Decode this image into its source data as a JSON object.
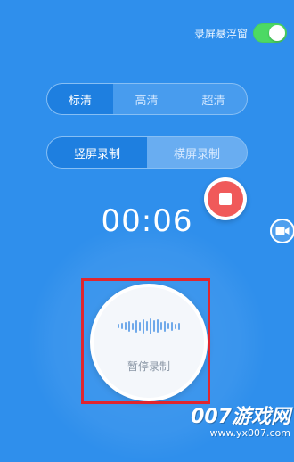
{
  "floating_window": {
    "label": "录屏悬浮窗",
    "enabled": true
  },
  "quality": {
    "options": [
      "标清",
      "高清",
      "超清"
    ],
    "selected": "标清"
  },
  "orientation": {
    "options": [
      "竖屏录制",
      "横屏录制"
    ],
    "selected": "竖屏录制"
  },
  "timer": "00:06",
  "pause": {
    "label": "暂停录制"
  },
  "watermark": {
    "logo": "007游戏网",
    "url": "www.yx007.com"
  },
  "colors": {
    "background": "#2f8fec",
    "active_segment": "#1e7fe0",
    "toggle_on": "#4cd964",
    "stop_red": "#f05a5a",
    "highlight_box": "#e0262e"
  },
  "icons": {
    "stop": "stop-square-icon",
    "camera": "video-camera-icon",
    "waveform": "audio-waveform-icon"
  }
}
